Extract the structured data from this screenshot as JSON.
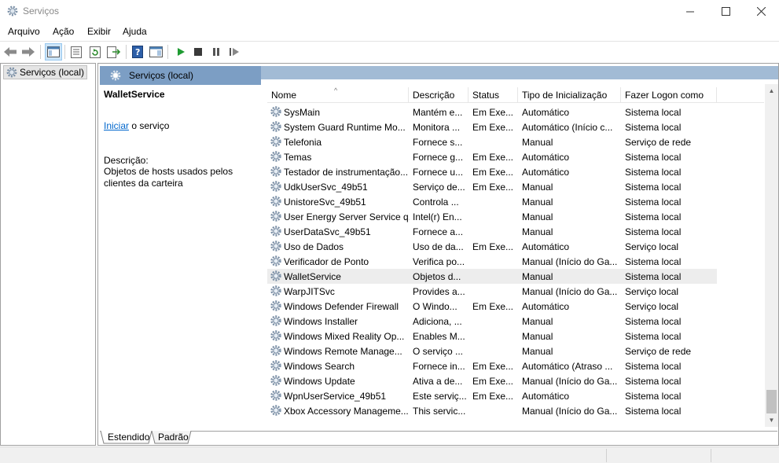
{
  "window": {
    "title": "Serviços",
    "app_icon": "services-gear-icon"
  },
  "menu": [
    "Arquivo",
    "Ação",
    "Exibir",
    "Ajuda"
  ],
  "tree": {
    "item_label": "Serviços (local)"
  },
  "pane": {
    "title": "Serviços (local)"
  },
  "details": {
    "service_name": "WalletService",
    "start_link": "Iniciar",
    "start_suffix": " o serviço",
    "description_label": "Descrição:",
    "description_text": "Objetos de hosts usados pelos clientes da carteira"
  },
  "columns": [
    "Nome",
    "Descrição",
    "Status",
    "Tipo de Inicialização",
    "Fazer Logon como"
  ],
  "rows": [
    {
      "name": "SysMain",
      "desc": "Mantém e...",
      "status": "Em Exe...",
      "start": "Automático",
      "logon": "Sistema local"
    },
    {
      "name": "System Guard Runtime Mo...",
      "desc": "Monitora ...",
      "status": "Em Exe...",
      "start": "Automático (Início c...",
      "logon": "Sistema local"
    },
    {
      "name": "Telefonia",
      "desc": "Fornece s...",
      "status": "",
      "start": "Manual",
      "logon": "Serviço de rede"
    },
    {
      "name": "Temas",
      "desc": "Fornece g...",
      "status": "Em Exe...",
      "start": "Automático",
      "logon": "Sistema local"
    },
    {
      "name": "Testador de instrumentação...",
      "desc": "Fornece u...",
      "status": "Em Exe...",
      "start": "Automático",
      "logon": "Sistema local"
    },
    {
      "name": "UdkUserSvc_49b51",
      "desc": "Serviço de...",
      "status": "Em Exe...",
      "start": "Manual",
      "logon": "Sistema local"
    },
    {
      "name": "UnistoreSvc_49b51",
      "desc": "Controla ...",
      "status": "",
      "start": "Manual",
      "logon": "Sistema local"
    },
    {
      "name": "User Energy Server Service q...",
      "desc": "Intel(r) En...",
      "status": "",
      "start": "Manual",
      "logon": "Sistema local"
    },
    {
      "name": "UserDataSvc_49b51",
      "desc": "Fornece a...",
      "status": "",
      "start": "Manual",
      "logon": "Sistema local"
    },
    {
      "name": "Uso de Dados",
      "desc": "Uso de da...",
      "status": "Em Exe...",
      "start": "Automático",
      "logon": "Serviço local"
    },
    {
      "name": "Verificador de Ponto",
      "desc": "Verifica po...",
      "status": "",
      "start": "Manual (Início do Ga...",
      "logon": "Sistema local"
    },
    {
      "name": "WalletService",
      "desc": "Objetos d...",
      "status": "",
      "start": "Manual",
      "logon": "Sistema local",
      "selected": true
    },
    {
      "name": "WarpJITSvc",
      "desc": "Provides a...",
      "status": "",
      "start": "Manual (Início do Ga...",
      "logon": "Serviço local"
    },
    {
      "name": "Windows Defender Firewall",
      "desc": "O Windo...",
      "status": "Em Exe...",
      "start": "Automático",
      "logon": "Serviço local"
    },
    {
      "name": "Windows Installer",
      "desc": "Adiciona, ...",
      "status": "",
      "start": "Manual",
      "logon": "Sistema local"
    },
    {
      "name": "Windows Mixed Reality Op...",
      "desc": "Enables M...",
      "status": "",
      "start": "Manual",
      "logon": "Sistema local"
    },
    {
      "name": "Windows Remote Manage...",
      "desc": "O serviço ...",
      "status": "",
      "start": "Manual",
      "logon": "Serviço de rede"
    },
    {
      "name": "Windows Search",
      "desc": "Fornece in...",
      "status": "Em Exe...",
      "start": "Automático (Atraso ...",
      "logon": "Sistema local"
    },
    {
      "name": "Windows Update",
      "desc": "Ativa a de...",
      "status": "Em Exe...",
      "start": "Manual (Início do Ga...",
      "logon": "Sistema local"
    },
    {
      "name": "WpnUserService_49b51",
      "desc": "Este serviç...",
      "status": "Em Exe...",
      "start": "Automático",
      "logon": "Sistema local"
    },
    {
      "name": "Xbox Accessory Manageme...",
      "desc": "This servic...",
      "status": "",
      "start": "Manual (Início do Ga...",
      "logon": "Sistema local"
    }
  ],
  "bottom_tabs": [
    "Estendido",
    "Padrão"
  ],
  "toolbar_icons": [
    "back-arrow-icon",
    "forward-arrow-icon",
    "console-tree-icon",
    "properties-icon",
    "refresh-icon",
    "export-list-icon",
    "help-icon",
    "show-hide-action-pane-icon",
    "start-service-icon",
    "stop-service-icon",
    "pause-service-icon",
    "restart-service-icon"
  ]
}
